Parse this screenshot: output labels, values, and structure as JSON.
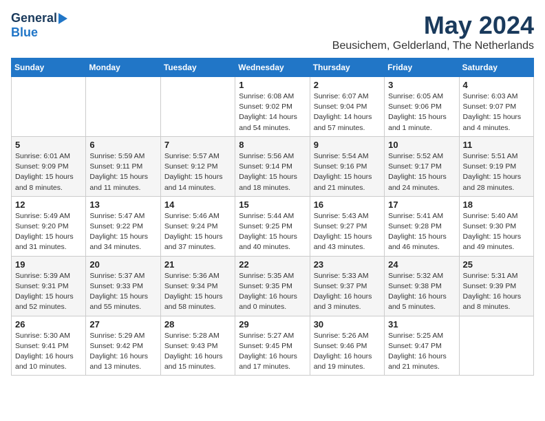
{
  "logo": {
    "general": "General",
    "blue": "Blue"
  },
  "title": "May 2024",
  "subtitle": "Beusichem, Gelderland, The Netherlands",
  "weekdays": [
    "Sunday",
    "Monday",
    "Tuesday",
    "Wednesday",
    "Thursday",
    "Friday",
    "Saturday"
  ],
  "weeks": [
    [
      {
        "day": "",
        "info": ""
      },
      {
        "day": "",
        "info": ""
      },
      {
        "day": "",
        "info": ""
      },
      {
        "day": "1",
        "info": "Sunrise: 6:08 AM\nSunset: 9:02 PM\nDaylight: 14 hours\nand 54 minutes."
      },
      {
        "day": "2",
        "info": "Sunrise: 6:07 AM\nSunset: 9:04 PM\nDaylight: 14 hours\nand 57 minutes."
      },
      {
        "day": "3",
        "info": "Sunrise: 6:05 AM\nSunset: 9:06 PM\nDaylight: 15 hours\nand 1 minute."
      },
      {
        "day": "4",
        "info": "Sunrise: 6:03 AM\nSunset: 9:07 PM\nDaylight: 15 hours\nand 4 minutes."
      }
    ],
    [
      {
        "day": "5",
        "info": "Sunrise: 6:01 AM\nSunset: 9:09 PM\nDaylight: 15 hours\nand 8 minutes."
      },
      {
        "day": "6",
        "info": "Sunrise: 5:59 AM\nSunset: 9:11 PM\nDaylight: 15 hours\nand 11 minutes."
      },
      {
        "day": "7",
        "info": "Sunrise: 5:57 AM\nSunset: 9:12 PM\nDaylight: 15 hours\nand 14 minutes."
      },
      {
        "day": "8",
        "info": "Sunrise: 5:56 AM\nSunset: 9:14 PM\nDaylight: 15 hours\nand 18 minutes."
      },
      {
        "day": "9",
        "info": "Sunrise: 5:54 AM\nSunset: 9:16 PM\nDaylight: 15 hours\nand 21 minutes."
      },
      {
        "day": "10",
        "info": "Sunrise: 5:52 AM\nSunset: 9:17 PM\nDaylight: 15 hours\nand 24 minutes."
      },
      {
        "day": "11",
        "info": "Sunrise: 5:51 AM\nSunset: 9:19 PM\nDaylight: 15 hours\nand 28 minutes."
      }
    ],
    [
      {
        "day": "12",
        "info": "Sunrise: 5:49 AM\nSunset: 9:20 PM\nDaylight: 15 hours\nand 31 minutes."
      },
      {
        "day": "13",
        "info": "Sunrise: 5:47 AM\nSunset: 9:22 PM\nDaylight: 15 hours\nand 34 minutes."
      },
      {
        "day": "14",
        "info": "Sunrise: 5:46 AM\nSunset: 9:24 PM\nDaylight: 15 hours\nand 37 minutes."
      },
      {
        "day": "15",
        "info": "Sunrise: 5:44 AM\nSunset: 9:25 PM\nDaylight: 15 hours\nand 40 minutes."
      },
      {
        "day": "16",
        "info": "Sunrise: 5:43 AM\nSunset: 9:27 PM\nDaylight: 15 hours\nand 43 minutes."
      },
      {
        "day": "17",
        "info": "Sunrise: 5:41 AM\nSunset: 9:28 PM\nDaylight: 15 hours\nand 46 minutes."
      },
      {
        "day": "18",
        "info": "Sunrise: 5:40 AM\nSunset: 9:30 PM\nDaylight: 15 hours\nand 49 minutes."
      }
    ],
    [
      {
        "day": "19",
        "info": "Sunrise: 5:39 AM\nSunset: 9:31 PM\nDaylight: 15 hours\nand 52 minutes."
      },
      {
        "day": "20",
        "info": "Sunrise: 5:37 AM\nSunset: 9:33 PM\nDaylight: 15 hours\nand 55 minutes."
      },
      {
        "day": "21",
        "info": "Sunrise: 5:36 AM\nSunset: 9:34 PM\nDaylight: 15 hours\nand 58 minutes."
      },
      {
        "day": "22",
        "info": "Sunrise: 5:35 AM\nSunset: 9:35 PM\nDaylight: 16 hours\nand 0 minutes."
      },
      {
        "day": "23",
        "info": "Sunrise: 5:33 AM\nSunset: 9:37 PM\nDaylight: 16 hours\nand 3 minutes."
      },
      {
        "day": "24",
        "info": "Sunrise: 5:32 AM\nSunset: 9:38 PM\nDaylight: 16 hours\nand 5 minutes."
      },
      {
        "day": "25",
        "info": "Sunrise: 5:31 AM\nSunset: 9:39 PM\nDaylight: 16 hours\nand 8 minutes."
      }
    ],
    [
      {
        "day": "26",
        "info": "Sunrise: 5:30 AM\nSunset: 9:41 PM\nDaylight: 16 hours\nand 10 minutes."
      },
      {
        "day": "27",
        "info": "Sunrise: 5:29 AM\nSunset: 9:42 PM\nDaylight: 16 hours\nand 13 minutes."
      },
      {
        "day": "28",
        "info": "Sunrise: 5:28 AM\nSunset: 9:43 PM\nDaylight: 16 hours\nand 15 minutes."
      },
      {
        "day": "29",
        "info": "Sunrise: 5:27 AM\nSunset: 9:45 PM\nDaylight: 16 hours\nand 17 minutes."
      },
      {
        "day": "30",
        "info": "Sunrise: 5:26 AM\nSunset: 9:46 PM\nDaylight: 16 hours\nand 19 minutes."
      },
      {
        "day": "31",
        "info": "Sunrise: 5:25 AM\nSunset: 9:47 PM\nDaylight: 16 hours\nand 21 minutes."
      },
      {
        "day": "",
        "info": ""
      }
    ]
  ]
}
